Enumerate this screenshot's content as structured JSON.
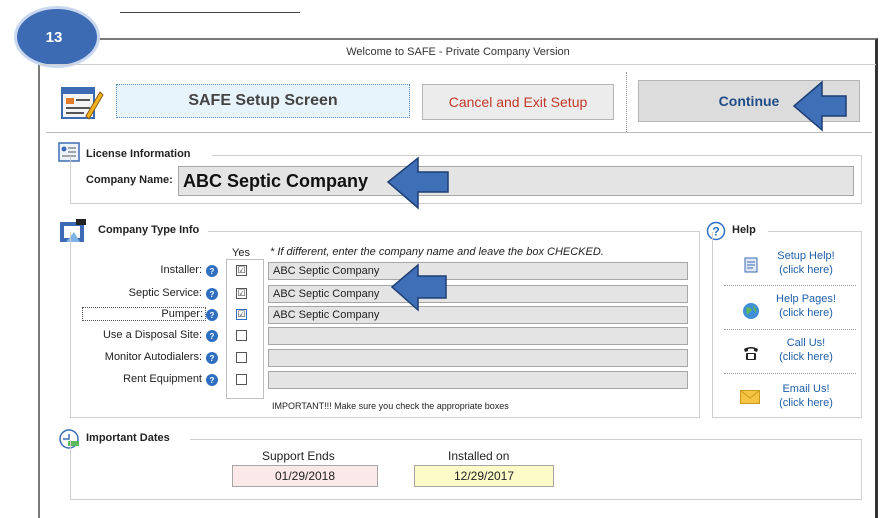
{
  "badge": "13",
  "window_title": "Welcome to SAFE - Private Company Version",
  "header": {
    "setup_title": "SAFE Setup Screen",
    "cancel_label": "Cancel and Exit Setup",
    "continue_label": "Continue"
  },
  "license": {
    "section_title": "License Information",
    "company_label": "Company Name:",
    "company_value": "ABC Septic Company"
  },
  "company_type": {
    "section_title": "Company Type Info",
    "yes_header": "Yes",
    "note": "* If different, enter the company name and leave the box CHECKED.",
    "rows": [
      {
        "label": "Installer:",
        "checked": "☑",
        "value": "ABC Septic Company"
      },
      {
        "label": "Septic Service:",
        "checked": "☑",
        "value": "ABC Septic Company"
      },
      {
        "label": "Pumper:",
        "checked": "☑",
        "value": "ABC Septic Company"
      },
      {
        "label": "Use a Disposal Site:",
        "checked": "",
        "value": ""
      },
      {
        "label": "Monitor Autodialers:",
        "checked": "",
        "value": ""
      },
      {
        "label": "Rent Equipment",
        "checked": "",
        "value": ""
      }
    ],
    "important": "IMPORTANT!!!  Make sure you check the appropriate boxes"
  },
  "help": {
    "section_title": "Help",
    "items": [
      {
        "line1": "Setup Help!",
        "line2": "(click here)"
      },
      {
        "line1": "Help Pages!",
        "line2": "(click here)"
      },
      {
        "line1": "Call Us!",
        "line2": "(click here)"
      },
      {
        "line1": "Email Us!",
        "line2": "(click here)"
      }
    ]
  },
  "dates": {
    "section_title": "Important Dates",
    "support_label": "Support Ends",
    "support_value": "01/29/2018",
    "installed_label": "Installed on",
    "installed_value": "12/29/2017"
  },
  "colors": {
    "badge": "#3d6bb3",
    "arrow": "#3f6fb7",
    "cancel_text": "#c0392b",
    "continue_text": "#1d4c87",
    "support_bg": "#fbe9ea",
    "installed_bg": "#fdfbc8"
  }
}
